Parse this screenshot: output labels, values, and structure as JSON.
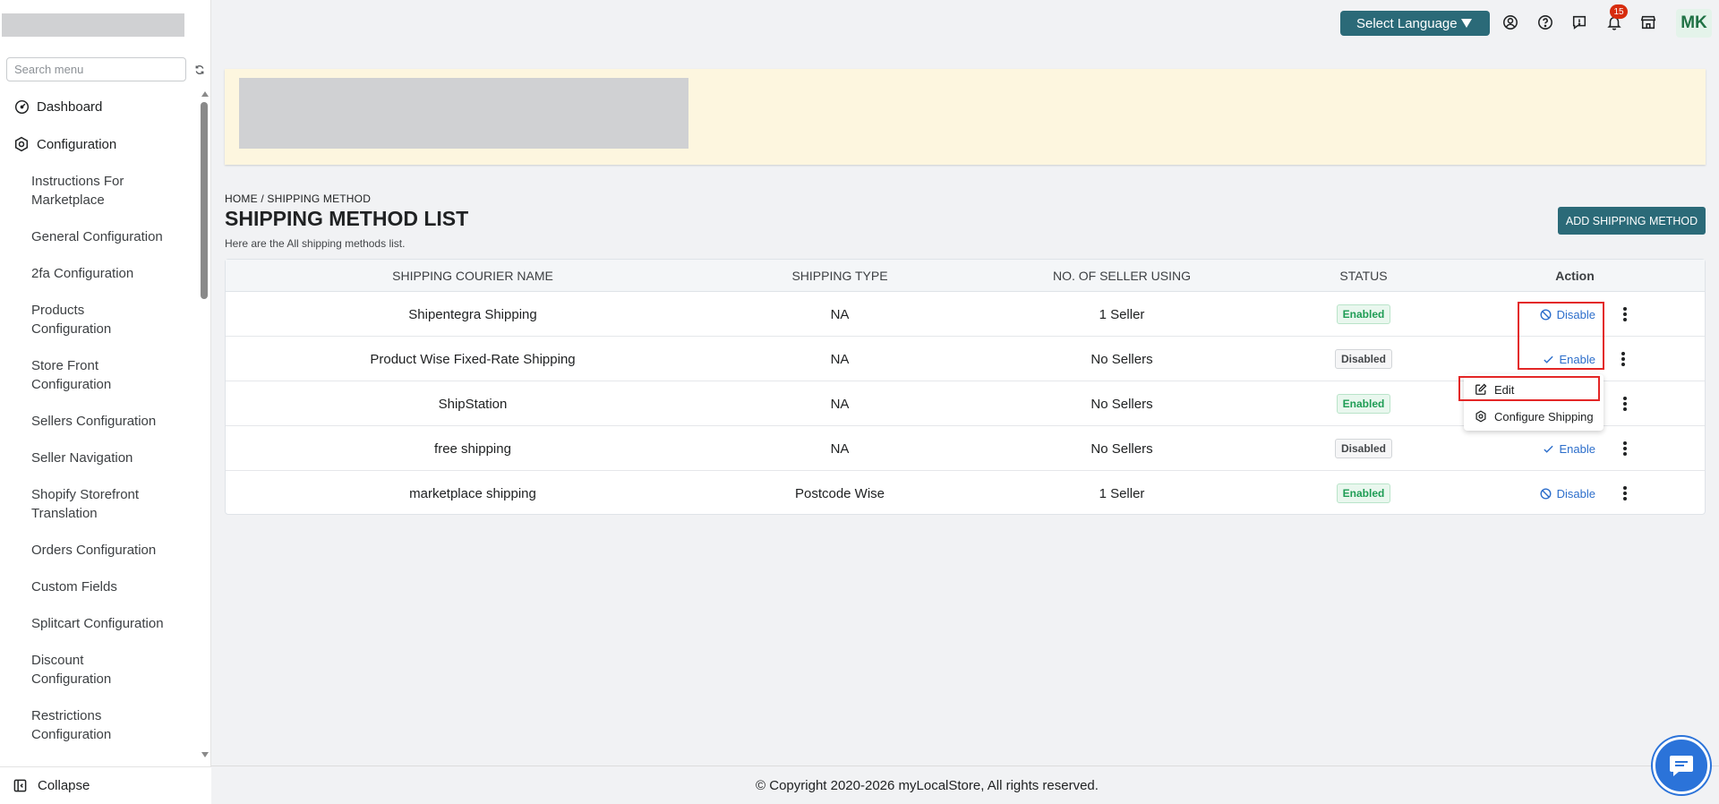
{
  "sidebar": {
    "search_placeholder": "Search menu",
    "top_items": [
      {
        "label": "Dashboard",
        "icon": "gauge-icon"
      },
      {
        "label": "Configuration",
        "icon": "hexagon-settings-icon"
      }
    ],
    "sub_items": [
      "Instructions For Marketplace",
      "General Configuration",
      "2fa Configuration",
      "Products Configuration",
      "Store Front Configuration",
      "Sellers Configuration",
      "Seller Navigation",
      "Shopify Storefront Translation",
      "Orders Configuration",
      "Custom Fields",
      "Splitcart Configuration",
      "Discount Configuration",
      "Restrictions Configuration"
    ],
    "collapse_label": "Collapse"
  },
  "topbar": {
    "language_label": "Select Language",
    "notification_count": "15",
    "avatar_initials": "MK",
    "icons": [
      "user-circle-icon",
      "help-circle-icon",
      "feedback-icon",
      "bell-icon",
      "store-icon"
    ]
  },
  "page": {
    "breadcrumb": "HOME / SHIPPING METHOD",
    "title": "SHIPPING METHOD LIST",
    "subtitle": "Here are the All shipping methods list.",
    "add_button": "ADD SHIPPING METHOD"
  },
  "table": {
    "headers": [
      "SHIPPING COURIER NAME",
      "SHIPPING TYPE",
      "NO. OF SELLER USING",
      "STATUS",
      "Action"
    ],
    "rows": [
      {
        "name": "Shipentegra Shipping",
        "type": "NA",
        "sellers": "1 Seller",
        "status": "Enabled",
        "action": "Disable"
      },
      {
        "name": "Product Wise Fixed-Rate Shipping",
        "type": "NA",
        "sellers": "No Sellers",
        "status": "Disabled",
        "action": "Enable"
      },
      {
        "name": "ShipStation",
        "type": "NA",
        "sellers": "No Sellers",
        "status": "Enabled",
        "action": ""
      },
      {
        "name": "free shipping",
        "type": "NA",
        "sellers": "No Sellers",
        "status": "Disabled",
        "action": "Enable"
      },
      {
        "name": "marketplace shipping",
        "type": "Postcode Wise",
        "sellers": "1 Seller",
        "status": "Enabled",
        "action": "Disable"
      }
    ]
  },
  "dropdown": {
    "items": [
      {
        "label": "Edit",
        "icon": "edit-icon"
      },
      {
        "label": "Configure Shipping",
        "icon": "hexagon-settings-icon"
      }
    ]
  },
  "footer": {
    "copyright": "© Copyright 2020-2026 myLocalStore, All rights reserved."
  },
  "colors": {
    "primary": "#2b6a78",
    "link": "#2c6ecb",
    "enabled": "#1f9d55",
    "highlight": "#e32626",
    "banner": "#fdf6df"
  }
}
